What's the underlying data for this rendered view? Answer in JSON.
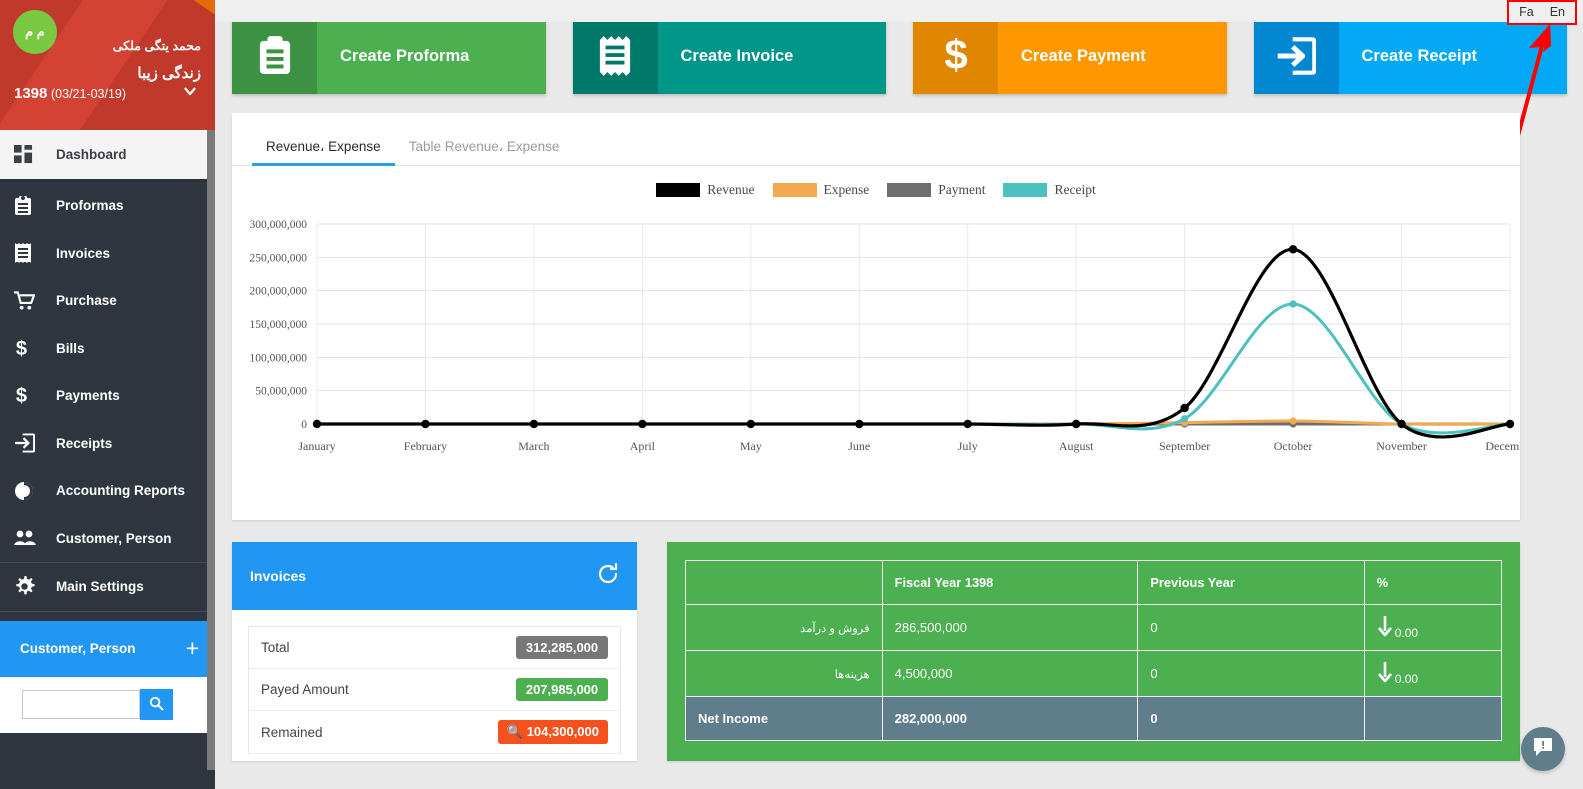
{
  "sidebar": {
    "avatar_initials": "م م",
    "user_name": "محمد یتگی ملکی",
    "business_name": "زندگی زیبا",
    "fiscal_year": "1398",
    "fiscal_range": "(03/21-03/19)",
    "chevron_icon": "chevron-down-icon",
    "items": [
      {
        "label": "Dashboard",
        "icon": "dashboard-grid-icon",
        "active": true
      },
      {
        "label": "Proformas",
        "icon": "clipboard-icon",
        "active": false
      },
      {
        "label": "Invoices",
        "icon": "invoice-receipt-icon",
        "active": false
      },
      {
        "label": "Purchase",
        "icon": "shopping-cart-icon",
        "active": false
      },
      {
        "label": "Bills",
        "icon": "dollar-sign-icon",
        "active": false
      },
      {
        "label": "Payments",
        "icon": "dollar-sign-icon",
        "active": false
      },
      {
        "label": "Receipts",
        "icon": "arrow-into-box-icon",
        "active": false
      },
      {
        "label": "Accounting Reports",
        "icon": "pie-chart-icon",
        "active": false
      },
      {
        "label": "Customer, Person",
        "icon": "people-icon",
        "active": false
      },
      {
        "label": "Main Settings",
        "icon": "gear-icon",
        "active": false
      }
    ],
    "customer_panel": {
      "label": "Customer, Person",
      "add_icon": "plus-icon"
    },
    "search": {
      "value": "",
      "placeholder": "",
      "button_icon": "search-icon"
    }
  },
  "topbar": {
    "lang_fa": "Fa",
    "lang_en": "En"
  },
  "action_cards": [
    {
      "title": "Create Proforma",
      "icon": "clipboard-icon",
      "color": "#4CAF50",
      "icon_bg": "#3d9142"
    },
    {
      "title": "Create Invoice",
      "icon": "invoice-receipt-icon",
      "color": "#009688",
      "icon_bg": "#00796b"
    },
    {
      "title": "Create Payment",
      "icon": "dollar-sign-icon",
      "color": "#FF9800",
      "icon_bg": "#e08600"
    },
    {
      "title": "Create Receipt",
      "icon": "arrow-into-box-icon",
      "color": "#03A9F4",
      "icon_bg": "#0288d1"
    }
  ],
  "chart_panel": {
    "tabs": [
      {
        "label": "Revenue، Expense",
        "active": true
      },
      {
        "label": "Table Revenue، Expense",
        "active": false
      }
    ]
  },
  "chart_data": {
    "type": "line",
    "title": "",
    "xlabel": "",
    "ylabel": "",
    "grid": true,
    "legend_position": "top-center",
    "ylim": [
      0,
      300000000
    ],
    "yticks": [
      0,
      50000000,
      100000000,
      150000000,
      200000000,
      250000000,
      300000000
    ],
    "ytick_labels": [
      "0",
      "50,000,000",
      "100,000,000",
      "150,000,000",
      "200,000,000",
      "250,000,000",
      "300,000,000"
    ],
    "categories": [
      "January",
      "February",
      "March",
      "April",
      "May",
      "June",
      "July",
      "August",
      "September",
      "October",
      "November",
      "December"
    ],
    "series": [
      {
        "name": "Revenue",
        "color": "#000000",
        "values": [
          0,
          0,
          0,
          0,
          0,
          0,
          0,
          0,
          24000000,
          262000000,
          0,
          0
        ]
      },
      {
        "name": "Expense",
        "color": "#F5A94E",
        "values": [
          0,
          0,
          0,
          0,
          0,
          0,
          0,
          0,
          2000000,
          4500000,
          0,
          0
        ]
      },
      {
        "name": "Payment",
        "color": "#6E6E6E",
        "values": [
          0,
          0,
          0,
          0,
          0,
          0,
          0,
          0,
          0,
          0,
          0,
          0
        ]
      },
      {
        "name": "Receipt",
        "color": "#4DC0C0",
        "values": [
          0,
          0,
          0,
          0,
          0,
          0,
          0,
          0,
          8000000,
          180000000,
          0,
          0
        ]
      }
    ]
  },
  "invoices_card": {
    "title": "Invoices",
    "refresh_icon": "refresh-icon",
    "rows": [
      {
        "label": "Total",
        "value": "312,285,000",
        "style": "grey",
        "icon": ""
      },
      {
        "label": "Payed Amount",
        "value": "207,985,000",
        "style": "green",
        "icon": ""
      },
      {
        "label": "Remained",
        "value": "104,300,000",
        "style": "orange",
        "icon": "search-icon"
      }
    ]
  },
  "financial_table": {
    "headers": [
      "",
      "Fiscal Year 1398",
      "Previous Year",
      "%"
    ],
    "rows": [
      {
        "label": "فروش و درآمد",
        "current": "286,500,000",
        "previous": "0",
        "pct": "0.00",
        "trend": "down"
      },
      {
        "label": "هزینه‌ها",
        "current": "4,500,000",
        "previous": "0",
        "pct": "0.00",
        "trend": "down"
      }
    ],
    "net_row": {
      "label": "Net Income",
      "current": "282,000,000",
      "previous": "0",
      "pct": ""
    }
  },
  "fab": {
    "icon": "chat-alert-icon"
  },
  "colors": {
    "accent_blue": "#2196f3",
    "sidebar_bg": "#2f3640",
    "green": "#4caf50",
    "net_row": "#607d8b",
    "highlight_red": "#ff0000"
  }
}
